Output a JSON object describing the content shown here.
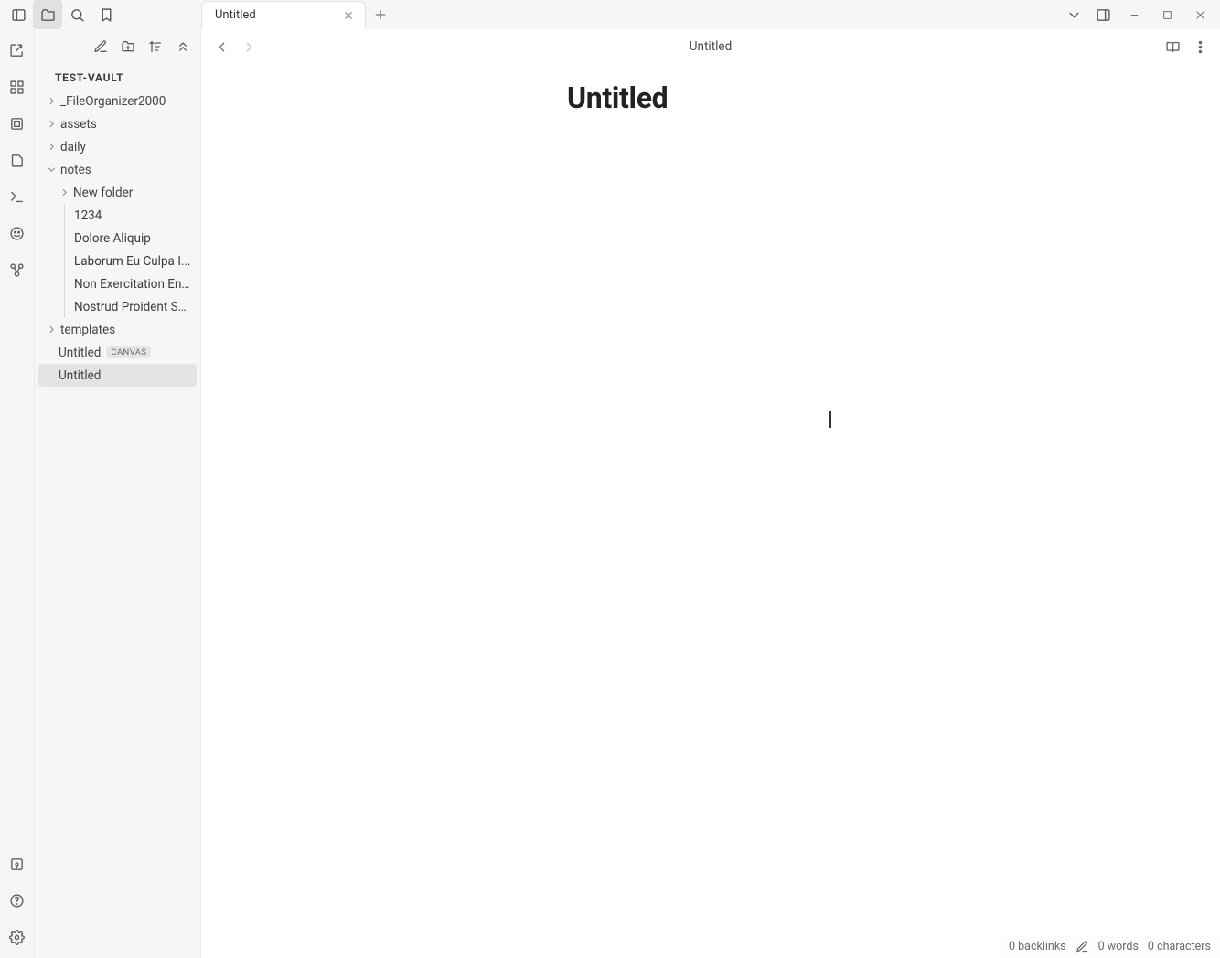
{
  "titlebar": {
    "tab_label": "Untitled"
  },
  "sidebar": {
    "vault": "TEST-VAULT",
    "items": [
      {
        "label": "_FileOrganizer2000",
        "type": "folder",
        "expanded": false,
        "depth": 0
      },
      {
        "label": "assets",
        "type": "folder",
        "expanded": false,
        "depth": 0
      },
      {
        "label": "daily",
        "type": "folder",
        "expanded": false,
        "depth": 0
      },
      {
        "label": "notes",
        "type": "folder",
        "expanded": true,
        "depth": 0
      },
      {
        "label": "New folder",
        "type": "folder",
        "expanded": false,
        "depth": 1
      },
      {
        "label": "1234",
        "type": "file",
        "depth": 2
      },
      {
        "label": "Dolore Aliquip",
        "type": "file",
        "depth": 2
      },
      {
        "label": "Laborum Eu Culpa I...",
        "type": "file",
        "depth": 2
      },
      {
        "label": "Non Exercitation Eni...",
        "type": "file",
        "depth": 2
      },
      {
        "label": "Nostrud Proident Su...",
        "type": "file",
        "depth": 2
      },
      {
        "label": "templates",
        "type": "folder",
        "expanded": false,
        "depth": 0
      },
      {
        "label": "Untitled",
        "type": "file",
        "depth": 0,
        "badge": "CANVAS"
      },
      {
        "label": "Untitled",
        "type": "file",
        "depth": 0,
        "active": true
      }
    ]
  },
  "view": {
    "breadcrumb": "Untitled",
    "note_title": "Untitled"
  },
  "status": {
    "backlinks": "0 backlinks",
    "words": "0 words",
    "chars": "0 characters"
  }
}
